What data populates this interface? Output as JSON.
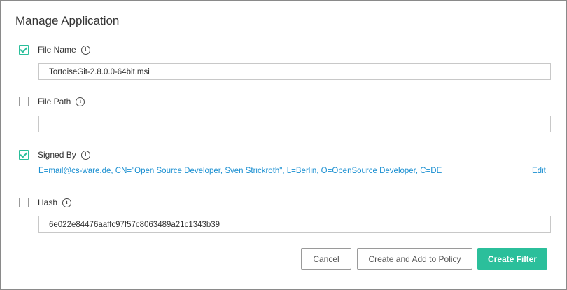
{
  "dialog": {
    "title": "Manage Application"
  },
  "file_name": {
    "label": "File Name",
    "checked": true,
    "value": "TortoiseGit-2.8.0.0-64bit.msi",
    "info_icon": "info-icon"
  },
  "file_path": {
    "label": "File Path",
    "checked": false,
    "value": "",
    "info_icon": "info-icon"
  },
  "signed_by": {
    "label": "Signed By",
    "checked": true,
    "value": "E=mail@cs-ware.de, CN=\"Open Source Developer, Sven Strickroth\", L=Berlin, O=OpenSource Developer, C=DE",
    "edit_label": "Edit",
    "info_icon": "info-icon"
  },
  "hash": {
    "label": "Hash",
    "checked": false,
    "value": "6e022e84476aaffc97f57c8063489a21c1343b39",
    "info_icon": "info-icon"
  },
  "buttons": {
    "cancel": "Cancel",
    "create_add": "Create and Add to Policy",
    "create_filter": "Create Filter"
  },
  "colors": {
    "accent": "#2bbf9b",
    "link": "#1a8fd1"
  }
}
